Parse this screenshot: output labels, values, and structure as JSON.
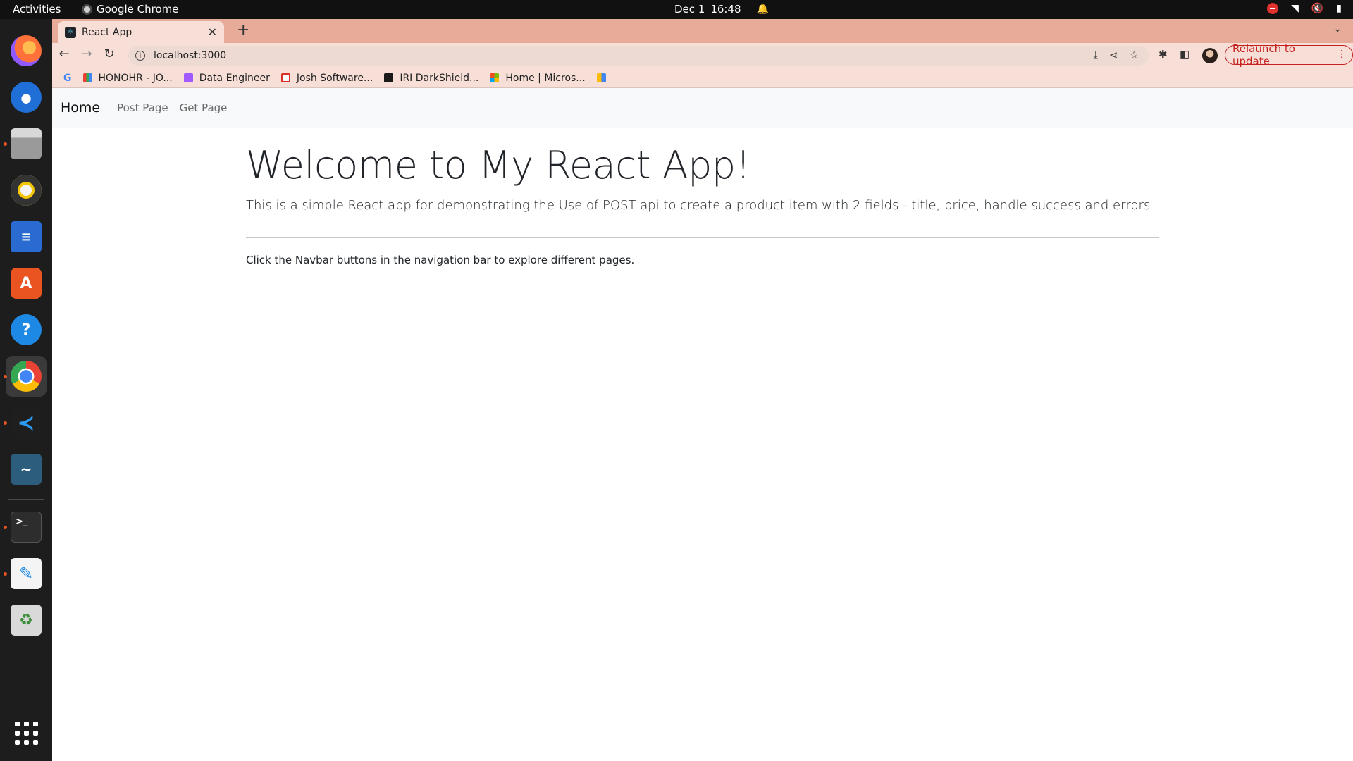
{
  "topbar": {
    "activities": "Activities",
    "app_name": "Google Chrome",
    "date": "Dec 1",
    "time": "16:48"
  },
  "dock": {
    "items": [
      {
        "name": "firefox",
        "icon": "firefox-icon"
      },
      {
        "name": "thunderbird",
        "icon": "thunderbird-icon"
      },
      {
        "name": "files",
        "icon": "files-icon"
      },
      {
        "name": "rhythmbox",
        "icon": "rhythmbox-icon"
      },
      {
        "name": "libreoffice-writer",
        "icon": "writer-icon"
      },
      {
        "name": "ubuntu-software",
        "icon": "software-icon"
      },
      {
        "name": "help",
        "icon": "help-icon"
      },
      {
        "name": "google-chrome",
        "icon": "chrome-icon"
      },
      {
        "name": "vscode",
        "icon": "vscode-icon"
      },
      {
        "name": "mysql-workbench",
        "icon": "mysql-workbench-icon"
      },
      {
        "name": "terminal",
        "icon": "terminal-icon"
      },
      {
        "name": "text-editor",
        "icon": "text-editor-icon"
      },
      {
        "name": "trash",
        "icon": "trash-icon"
      },
      {
        "name": "show-applications",
        "icon": "apps-grid-icon"
      }
    ]
  },
  "browser": {
    "tab_title": "React App",
    "url": "localhost:3000",
    "relaunch_label": "Relaunch to update",
    "bookmarks": [
      {
        "label": "HONOHR - JO...",
        "color": "#e94235"
      },
      {
        "label": "Data Engineer",
        "color": "#a259ff"
      },
      {
        "label": "Josh Software...",
        "color": "#d93025"
      },
      {
        "label": "IRI DarkShield...",
        "color": "#1a1a1a"
      },
      {
        "label": "Home | Micros...",
        "color": "#f25022"
      }
    ]
  },
  "page": {
    "navbar": {
      "brand": "Home",
      "links": [
        "Post Page",
        "Get Page"
      ]
    },
    "heading": "Welcome to My React App!",
    "lead": "This is a simple React app for demonstrating the Use of POST api to create a product item with 2 fields - title, price, handle success and errors.",
    "body": "Click the Navbar buttons in the navigation bar to explore different pages."
  },
  "colors": {
    "tabstrip": "#e7ab99",
    "toolbar": "#f7dfd7",
    "relaunch": "#c5221f",
    "navbar_bg": "#f8f9fa"
  }
}
